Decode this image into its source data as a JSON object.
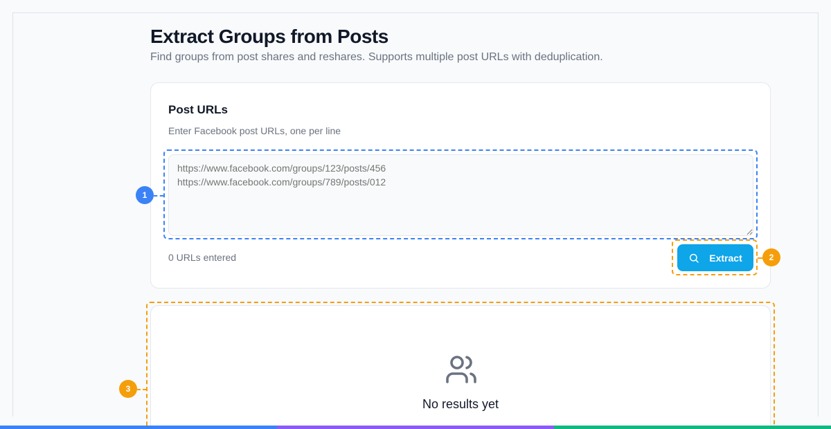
{
  "page": {
    "title": "Extract Groups from Posts",
    "subtitle": "Find groups from post shares and reshares. Supports multiple post URLs with deduplication."
  },
  "input_card": {
    "title": "Post URLs",
    "description": "Enter Facebook post URLs, one per line",
    "textarea_placeholder": "https://www.facebook.com/groups/123/posts/456\nhttps://www.facebook.com/groups/789/posts/012",
    "url_count": "0 URLs entered",
    "extract_label": "Extract",
    "extract_icon": "search-icon"
  },
  "results": {
    "empty_icon": "users-icon",
    "empty_title": "No results yet"
  },
  "annotations": [
    {
      "label": "1",
      "color": "#3b82f6"
    },
    {
      "label": "2",
      "color": "#f59e0b"
    },
    {
      "label": "3",
      "color": "#f59e0b"
    }
  ],
  "colors": {
    "accent": "#0ea5e9",
    "annotation_blue": "#3b82f6",
    "annotation_orange": "#f59e0b",
    "bottom_bar": [
      "#3b82f6",
      "#8b5cf6",
      "#10b981"
    ]
  }
}
